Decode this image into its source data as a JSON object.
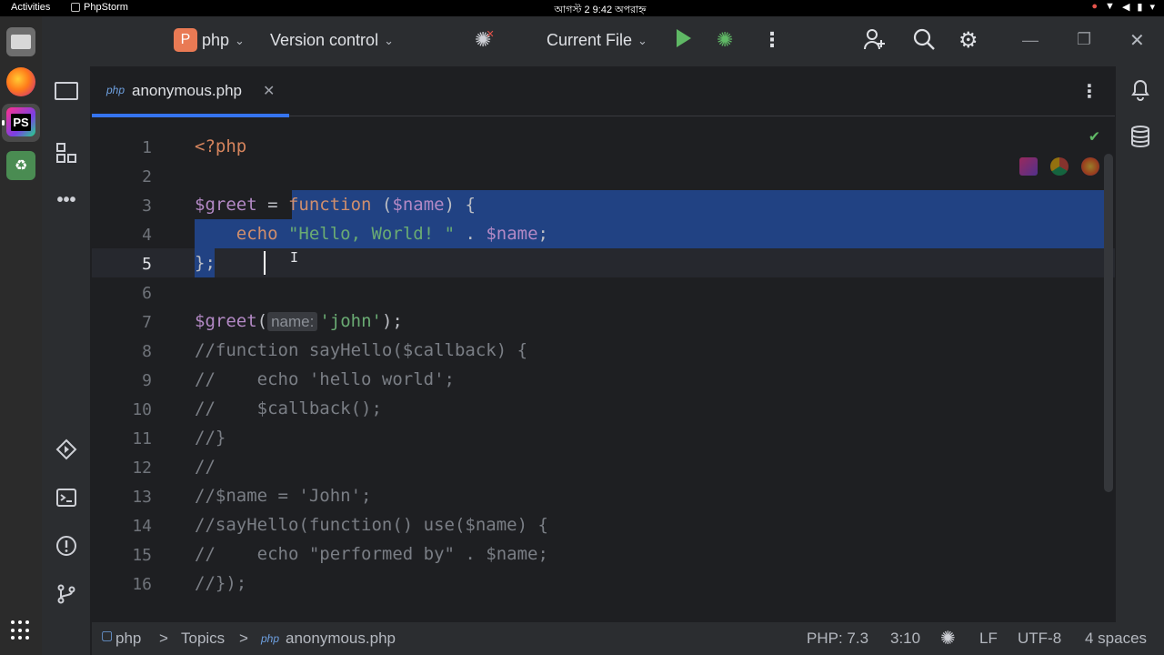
{
  "system": {
    "activities": "Activities",
    "app_name": "PhpStorm",
    "clock": "আগস্ট 2  9:42 অপরাহ্ন"
  },
  "toolbar": {
    "project_badge": "P",
    "project_name": "php",
    "version_control": "Version control",
    "run_config": "Current File"
  },
  "tab": {
    "icon": "php",
    "file_name": "anonymous.php",
    "close": "✕"
  },
  "editor": {
    "line_numbers": [
      "1",
      "2",
      "3",
      "4",
      "5",
      "6",
      "7",
      "8",
      "9",
      "10",
      "11",
      "12",
      "13",
      "14",
      "15",
      "16"
    ],
    "current_line": 5,
    "selection_lines": [
      3,
      4,
      5
    ],
    "param_hint": "name:",
    "code": {
      "l1_tag": "<?php",
      "l3_var": "$greet",
      "l3_eq": " = ",
      "l3_kw": "function",
      "l3_open": " (",
      "l3_param": "$name",
      "l3_close": ") {",
      "l4_indent": "    ",
      "l4_kw": "echo",
      "l4_sp": " ",
      "l4_str": "\"Hello, World! \"",
      "l4_dot": " . ",
      "l4_var": "$name",
      "l4_end": ";",
      "l5": "};",
      "l7_var": "$greet",
      "l7_paren": "(",
      "l7_str": "'john'",
      "l7_end": ");",
      "l8": "//function sayHello($callback) {",
      "l9": "//    echo 'hello world';",
      "l10": "//    $callback();",
      "l11": "//}",
      "l12": "//",
      "l13": "//$name = 'John';",
      "l14": "//sayHello(function() use($name) {",
      "l15": "//    echo \"performed by\" . $name;",
      "l16": "//});"
    }
  },
  "statusbar": {
    "project": "php",
    "sep1": ">",
    "topics": "Topics",
    "sep2": ">",
    "file_icon": "php",
    "file": "anonymous.php",
    "php_version": "PHP: 7.3",
    "position": "3:10",
    "line_ending": "LF",
    "encoding": "UTF-8",
    "indent": "4 spaces"
  },
  "colors": {
    "accent": "#3574f0",
    "selection": "#214283",
    "run_green": "#5fb865",
    "project_badge": "#e97a54"
  }
}
